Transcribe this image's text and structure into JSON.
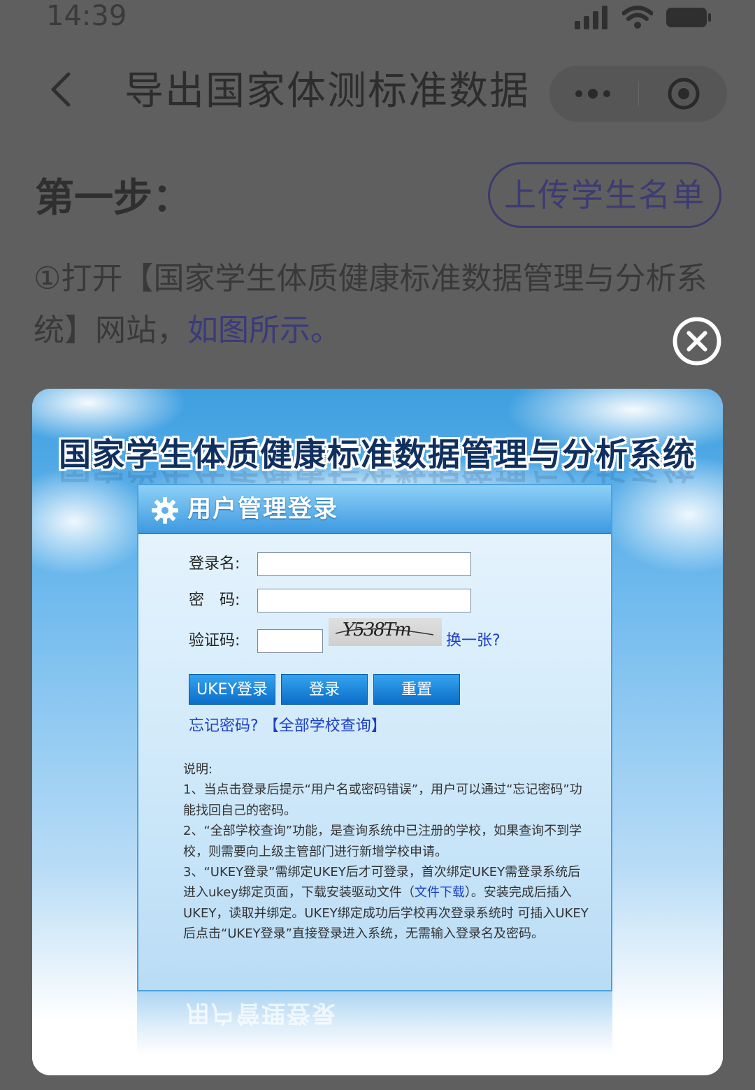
{
  "status_bar": {
    "time": "14:39"
  },
  "nav": {
    "title": "导出国家体测标准数据"
  },
  "step": {
    "title": "第一步：",
    "upload_button": "上传学生名单",
    "desc_text": "①打开【国家学生体质健康标准数据管理与分析系统】网站，",
    "desc_link": "如图所示。"
  },
  "screenshot": {
    "system_title": "国家学生体质健康标准数据管理与分析系统",
    "panel_title": "用户管理登录",
    "login_name_label": "登录名:",
    "password_label": "密　码:",
    "captcha_label": "验证码:",
    "captcha_text": "Y538Tm",
    "refresh_link": "换一张?",
    "buttons": {
      "ukey": "UKEY登录",
      "login": "登录",
      "reset": "重置"
    },
    "forgot_link": "忘记密码?",
    "schools_link": "【全部学校查询】",
    "notes": {
      "heading": "说明:",
      "n1": "1、当点击登录后提示“用户名或密码错误”，用户可以通过“忘记密码”功能找回自己的密码。",
      "n2": "2、“全部学校查询”功能，是查询系统中已注册的学校，如果查询不到学校，则需要向上级主管部门进行新增学校申请。",
      "n3a": "3、“UKEY登录”需绑定UKEY后才可登录，首次绑定UKEY需登录系统后进入ukey绑定页面，下载安装驱动文件（",
      "n3link": "文件下载",
      "n3b": "）。安装完成后插入UKEY，读取并绑定。UKEY绑定成功后学校再次登录系统时 可插入UKEY后点击“UKEY登录”直接登录进入系统，无需输入登录名及密码。"
    }
  },
  "colors": {
    "overlay": "#5f5f5f",
    "accent": "#3d3b72",
    "panel_blue": "#3e9ae0",
    "link_blue": "#1d3fc7"
  },
  "icons": [
    "signal-icon",
    "wifi-icon",
    "battery-icon",
    "back-icon",
    "more-icon",
    "target-icon",
    "close-icon",
    "gear-icon"
  ]
}
